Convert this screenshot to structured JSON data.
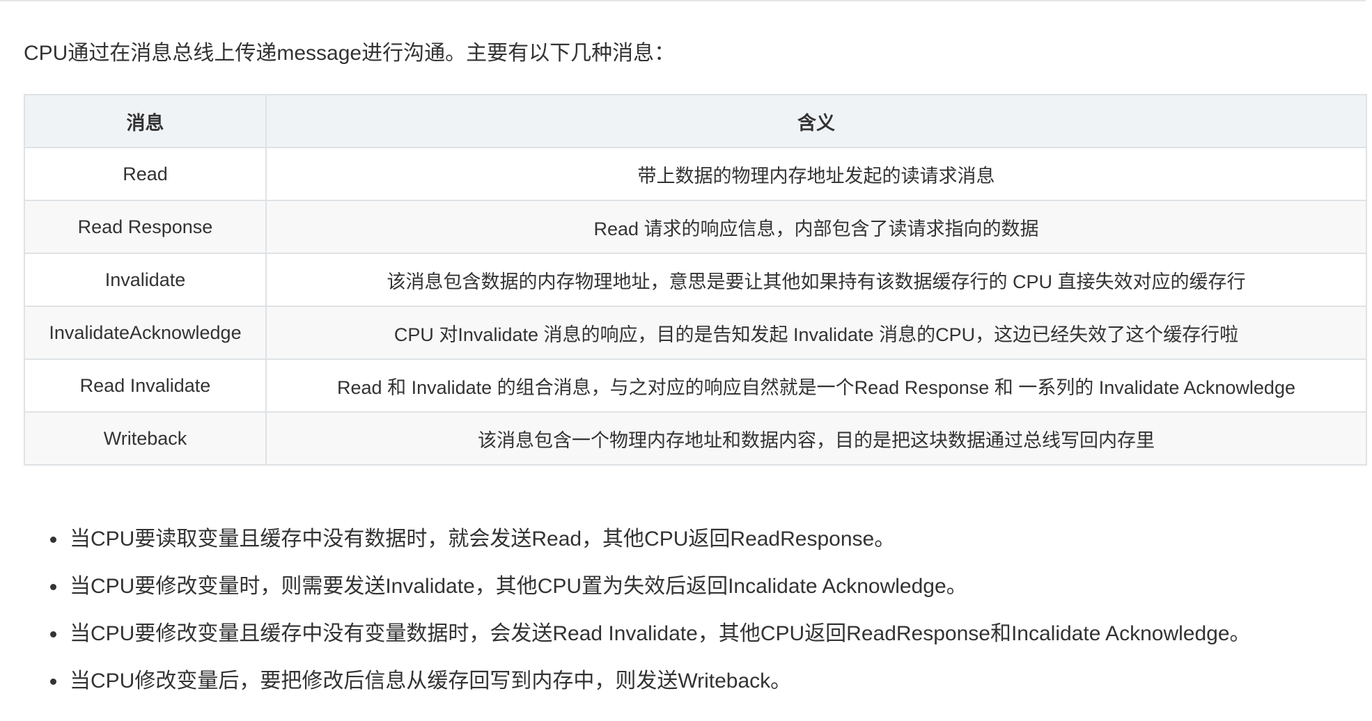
{
  "intro": "CPU通过在消息总线上传递message进行沟通。主要有以下几种消息：",
  "table": {
    "headers": [
      "消息",
      "含义"
    ],
    "rows": [
      {
        "message": "Read",
        "meaning": "带上数据的物理内存地址发起的读请求消息"
      },
      {
        "message": "Read Response",
        "meaning": "Read 请求的响应信息，内部包含了读请求指向的数据"
      },
      {
        "message": "Invalidate",
        "meaning": "该消息包含数据的内存物理地址，意思是要让其他如果持有该数据缓存行的 CPU 直接失效对应的缓存行"
      },
      {
        "message": "InvalidateAcknowledge",
        "meaning": "CPU 对Invalidate 消息的响应，目的是告知发起 Invalidate 消息的CPU，这边已经失效了这个缓存行啦"
      },
      {
        "message": "Read Invalidate",
        "meaning": "Read 和 Invalidate 的组合消息，与之对应的响应自然就是一个Read Response 和 一系列的 Invalidate Acknowledge"
      },
      {
        "message": "Writeback",
        "meaning": "该消息包含一个物理内存地址和数据内容，目的是把这块数据通过总线写回内存里"
      }
    ]
  },
  "notes": [
    "当CPU要读取变量且缓存中没有数据时，就会发送Read，其他CPU返回ReadResponse。",
    "当CPU要修改变量时，则需要发送Invalidate，其他CPU置为失效后返回Incalidate Acknowledge。",
    "当CPU要修改变量且缓存中没有变量数据时，会发送Read Invalidate，其他CPU返回ReadResponse和Incalidate Acknowledge。",
    "当CPU修改变量后，要把修改后信息从缓存回写到内存中，则发送Writeback。"
  ]
}
